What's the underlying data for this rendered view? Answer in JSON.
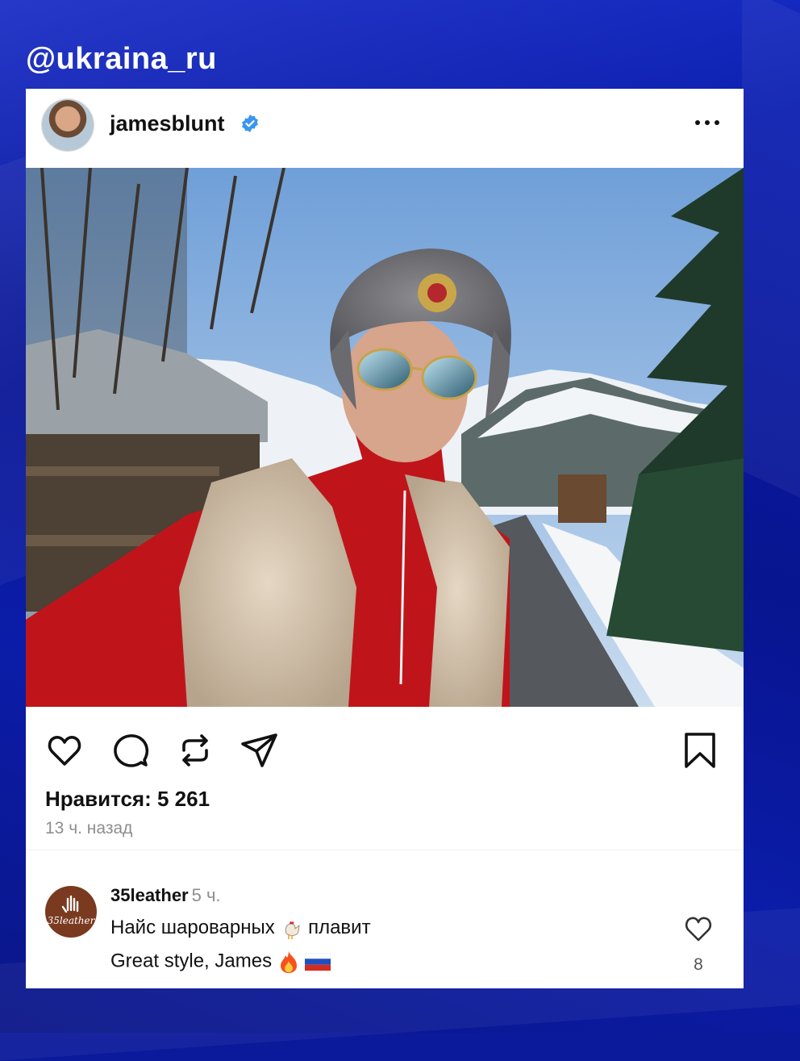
{
  "channel_handle": "@ukraina_ru",
  "post": {
    "username": "jamesblunt",
    "verified_icon": "verified-badge-icon",
    "more_icon": "more-dots-icon",
    "likes_text": "Нравится: 5 261",
    "time_text": "13 ч. назад",
    "actions": [
      "heart-icon",
      "comment-icon",
      "repost-icon",
      "share-icon",
      "bookmark-icon"
    ]
  },
  "comment": {
    "username": "35leather",
    "time": "5 ч.",
    "avatar_text": "35leather",
    "line1_before": "Найс шароварных",
    "line1_after": "плавит",
    "line2": "Great style, James",
    "like_count": "8"
  },
  "colors": {
    "background": "#0a1a9a",
    "verified": "#3897f0",
    "text": "#111111",
    "muted": "#8e8e8e"
  }
}
